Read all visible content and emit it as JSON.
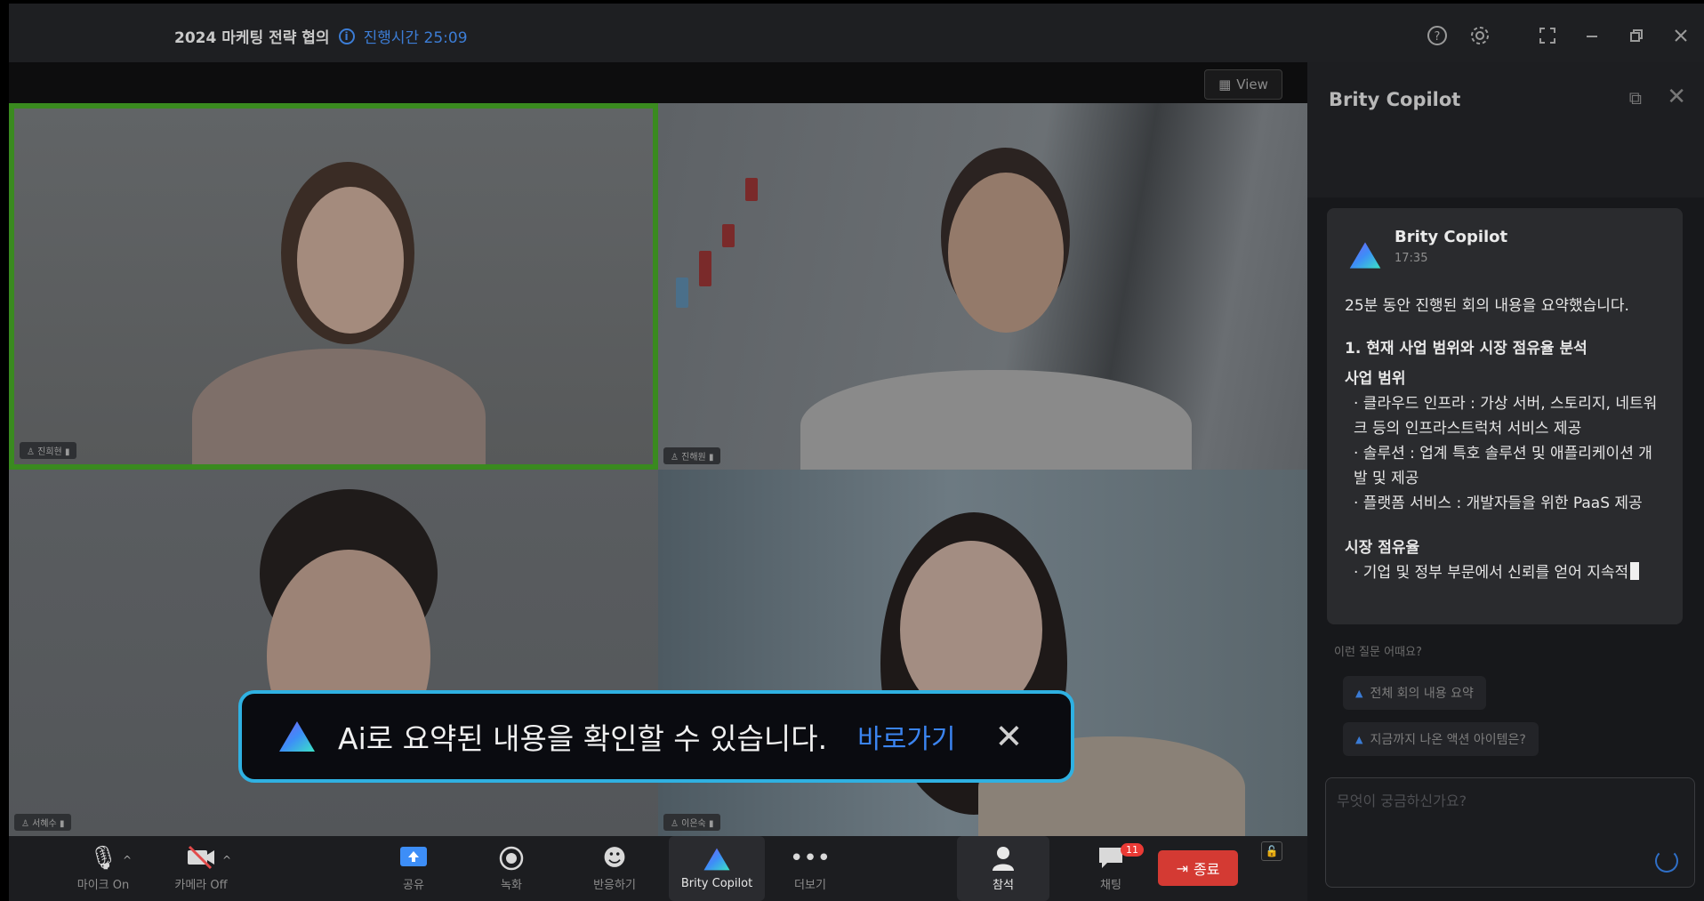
{
  "window": {
    "meeting_title": "2024 마케팅 전략 협의",
    "elapsed_label": "진행시간 25:09",
    "help_icon": "help-circle-icon",
    "settings_icon": "gear-icon"
  },
  "video": {
    "view_button_label": "View",
    "tiles": [
      {
        "name": "진희현"
      },
      {
        "name": "진해원"
      },
      {
        "name": "서혜수"
      },
      {
        "name": "이은숙"
      }
    ]
  },
  "toast": {
    "message": "Ai로 요약된 내용을 확인할 수 있습니다.",
    "link_label": "바로가기",
    "close_glyph": "✕"
  },
  "toolbar": {
    "mic_label": "마이크 On",
    "camera_label": "카메라 Off",
    "share_label": "공유",
    "record_label": "녹화",
    "reaction_label": "반응하기",
    "copilot_label": "Brity Copilot",
    "more_label": "더보기",
    "participants_label": "참석",
    "chat_label": "채팅",
    "chat_badge": "11",
    "end_label": "종료"
  },
  "panel": {
    "title": "Brity Copilot",
    "message": {
      "sender": "Brity Copilot",
      "time": "17:35",
      "intro": "25분 동안 진행된 회의 내용을 요약했습니다.",
      "section1": "1. 현재 사업 범위와 시장 점유율 분석",
      "sub1": "사업 범위",
      "bullets1": [
        "· 클라우드 인프라 : 가상 서버, 스토리지, 네트워크 등의 인프라스트럭처 서비스 제공",
        "· 솔루션 : 업계 특호 솔루션 및 애플리케이션 개발 및 제공",
        "· 플랫폼 서비스 : 개발자들을 위한 PaaS 제공"
      ],
      "sub2": "시장 점유율",
      "bullets2": [
        "· 기업 및 정부 부문에서 신뢰를 얻어 지속적"
      ]
    },
    "suggest_label": "이런 질문 어때요?",
    "suggestions": [
      "전체 회의 내용 요약",
      "지금까지 나온 액션 아이템은?"
    ],
    "input_placeholder": "무엇이 궁금하신가요?"
  }
}
